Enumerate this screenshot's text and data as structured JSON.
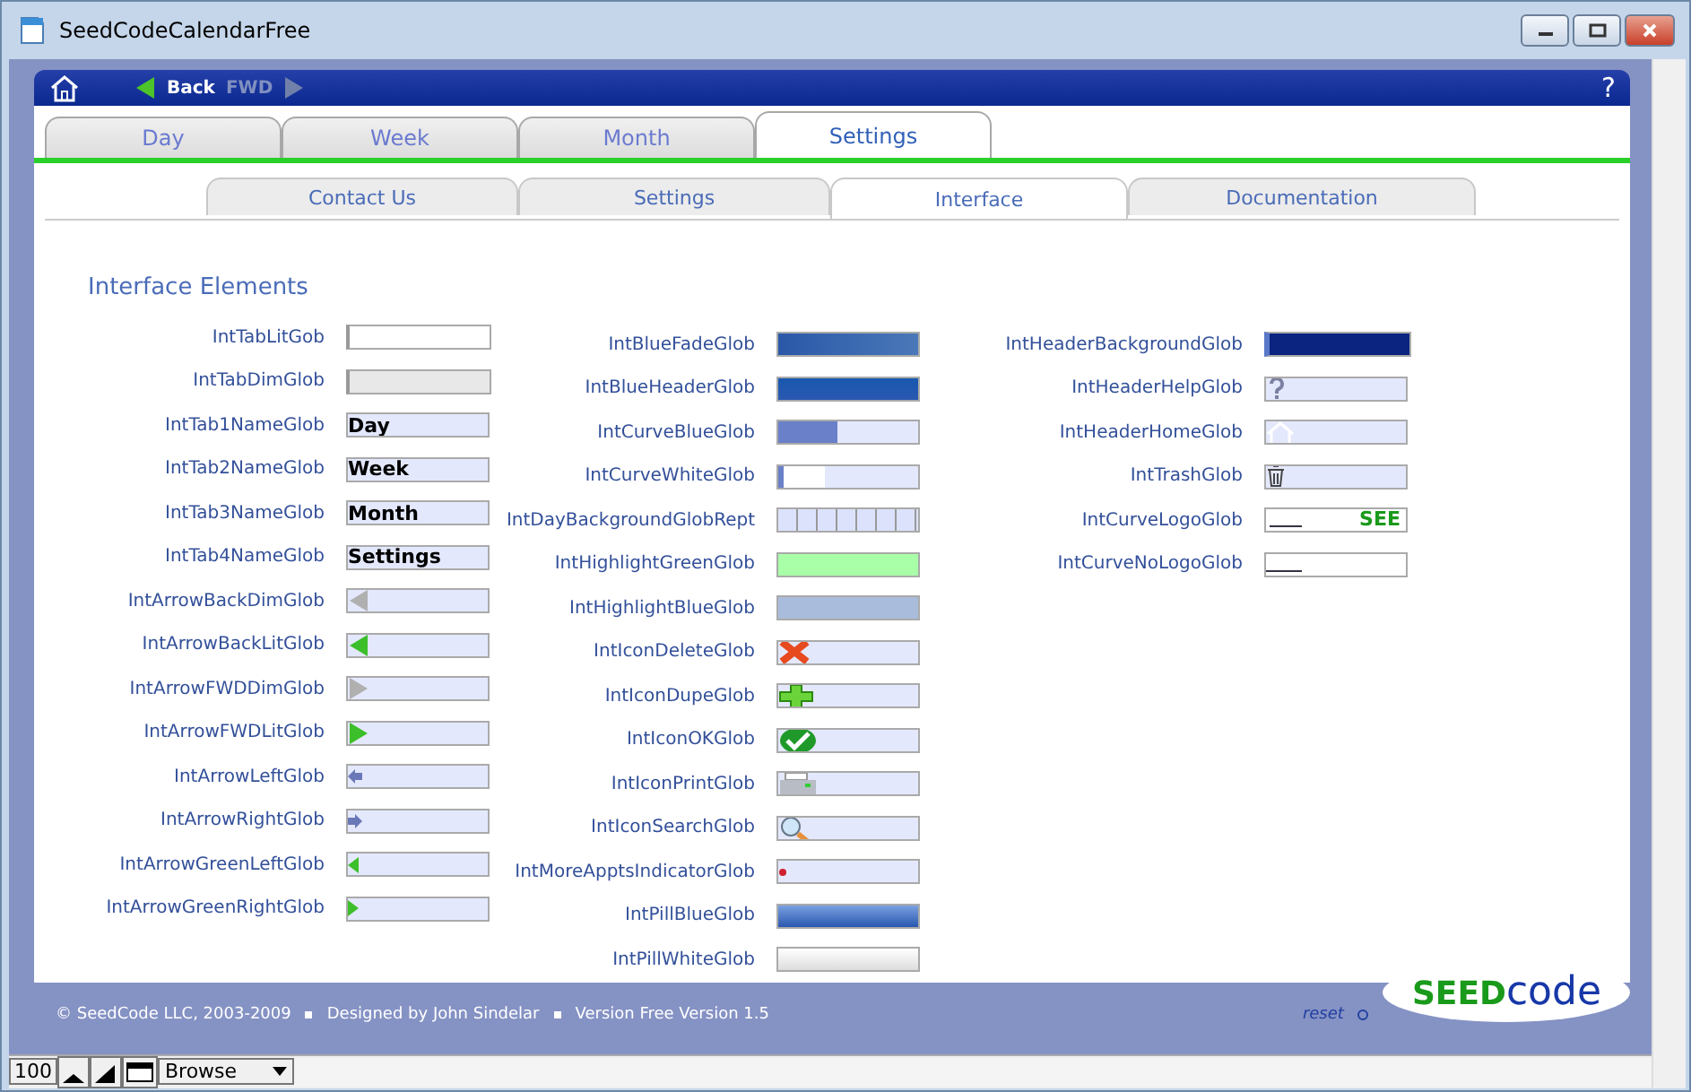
{
  "window": {
    "title": "SeedCodeCalendarFree"
  },
  "nav": {
    "back": "Back",
    "forward": "FWD",
    "help": "?"
  },
  "tabs": [
    {
      "label": "Day",
      "selected": false
    },
    {
      "label": "Week",
      "selected": false
    },
    {
      "label": "Month",
      "selected": false
    },
    {
      "label": "Settings",
      "selected": true
    }
  ],
  "subtabs": [
    {
      "label": "Contact Us",
      "selected": false
    },
    {
      "label": "Settings",
      "selected": false
    },
    {
      "label": "Interface",
      "selected": true
    },
    {
      "label": "Documentation",
      "selected": false
    }
  ],
  "section_title": "Interface Elements",
  "columns": [
    [
      {
        "label": "IntTabLitGob",
        "kind": "lit"
      },
      {
        "label": "IntTabDimGlob",
        "kind": "dim"
      },
      {
        "label": "IntTab1NameGlob",
        "kind": "name",
        "value": "Day"
      },
      {
        "label": "IntTab2NameGlob",
        "kind": "name",
        "value": "Week"
      },
      {
        "label": "IntTab3NameGlob",
        "kind": "name",
        "value": "Month"
      },
      {
        "label": "IntTab4NameGlob",
        "kind": "name",
        "value": "Settings"
      },
      {
        "label": "IntArrowBackDimGlob",
        "kind": "back-dim"
      },
      {
        "label": "IntArrowBackLitGlob",
        "kind": "back-lit"
      },
      {
        "label": "IntArrowFWDDimGlob",
        "kind": "fwd-dim"
      },
      {
        "label": "IntArrowFWDLitGlob",
        "kind": "fwd-lit"
      },
      {
        "label": "IntArrowLeftGlob",
        "kind": "small-left"
      },
      {
        "label": "IntArrowRightGlob",
        "kind": "small-right"
      },
      {
        "label": "IntArrowGreenLeftGlob",
        "kind": "green-left"
      },
      {
        "label": "IntArrowGreenRightGlob",
        "kind": "green-right"
      }
    ],
    [
      {
        "label": "IntBlueFadeGlob",
        "kind": "blue-fade"
      },
      {
        "label": "IntBlueHeaderGlob",
        "kind": "blue-header"
      },
      {
        "label": "IntCurveBlueGlob",
        "kind": "curve-blue"
      },
      {
        "label": "IntCurveWhiteGlob",
        "kind": "curve-white"
      },
      {
        "label": "IntDayBackgroundGlobRept",
        "kind": "day-grid"
      },
      {
        "label": "IntHighlightGreenGlob",
        "kind": "hl-green"
      },
      {
        "label": "IntHighlightBlueGlob",
        "kind": "hl-blue"
      },
      {
        "label": "IntIconDeleteGlob",
        "kind": "delete"
      },
      {
        "label": "IntIconDupeGlob",
        "kind": "dupe"
      },
      {
        "label": "IntIconOKGlob",
        "kind": "ok"
      },
      {
        "label": "IntIconPrintGlob",
        "kind": "print"
      },
      {
        "label": "IntIconSearchGlob",
        "kind": "search"
      },
      {
        "label": "IntMoreApptsIndicatorGlob",
        "kind": "dot"
      },
      {
        "label": "IntPillBlueGlob",
        "kind": "pill-blue"
      },
      {
        "label": "IntPillWhiteGlob",
        "kind": "pill-white"
      }
    ],
    [
      {
        "label": "IntHeaderBackgroundGlob",
        "kind": "header-bg"
      },
      {
        "label": "IntHeaderHelpGlob",
        "kind": "help"
      },
      {
        "label": "IntHeaderHomeGlob",
        "kind": "home"
      },
      {
        "label": "IntTrashGlob",
        "kind": "trash"
      },
      {
        "label": "IntCurveLogoGlob",
        "kind": "logo",
        "value": "SEE"
      },
      {
        "label": "IntCurveNoLogoGlob",
        "kind": "nologo"
      }
    ]
  ],
  "footer": {
    "items": [
      "© SeedCode LLC, 2003-2009",
      "Designed by John Sindelar",
      "Version Free Version 1.5"
    ],
    "reset": "reset",
    "logo_seed": "SEED",
    "logo_code": "code"
  },
  "status_bar": {
    "zoom": "100",
    "mode": "Browse"
  }
}
